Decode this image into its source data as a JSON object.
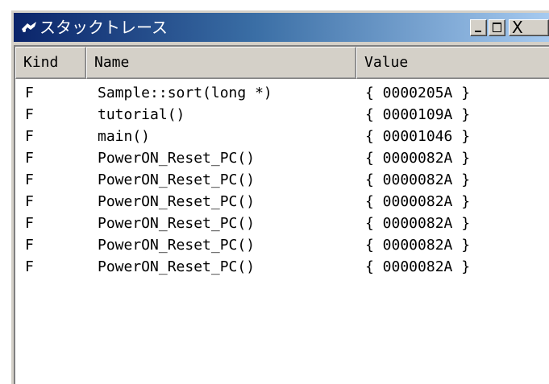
{
  "window": {
    "title": "スタックトレース",
    "close_glyph": "X"
  },
  "columns": {
    "kind": "Kind",
    "name": "Name",
    "value": "Value"
  },
  "rows": [
    {
      "kind": "F",
      "name": "Sample::sort(long *)",
      "value": "{ 0000205A }"
    },
    {
      "kind": "F",
      "name": "tutorial()",
      "value": "{ 0000109A }"
    },
    {
      "kind": "F",
      "name": "main()",
      "value": "{ 00001046 }"
    },
    {
      "kind": "F",
      "name": "PowerON_Reset_PC()",
      "value": "{ 0000082A }"
    },
    {
      "kind": "F",
      "name": "PowerON_Reset_PC()",
      "value": "{ 0000082A }"
    },
    {
      "kind": "F",
      "name": "PowerON_Reset_PC()",
      "value": "{ 0000082A }"
    },
    {
      "kind": "F",
      "name": "PowerON_Reset_PC()",
      "value": "{ 0000082A }"
    },
    {
      "kind": "F",
      "name": "PowerON_Reset_PC()",
      "value": "{ 0000082A }"
    },
    {
      "kind": "F",
      "name": "PowerON_Reset_PC()",
      "value": "{ 0000082A }"
    }
  ]
}
